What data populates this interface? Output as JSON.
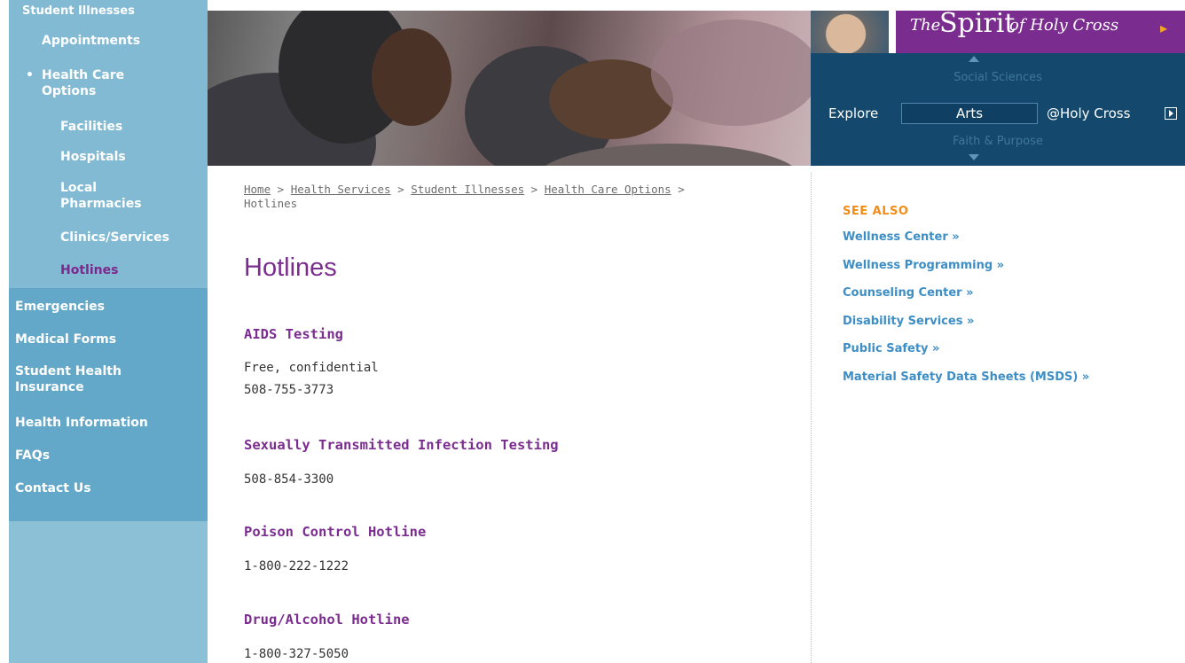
{
  "left_nav": {
    "sub_items": [
      {
        "label": "Student Illnesses"
      },
      {
        "label": "Appointments"
      },
      {
        "label": "Health Care Options",
        "bullet": "•"
      },
      {
        "label": "Facilities"
      },
      {
        "label": "Hospitals"
      },
      {
        "label": "Local Pharmacies"
      },
      {
        "label": "Clinics/Services"
      },
      {
        "label": "Hotlines"
      }
    ],
    "main_items": [
      {
        "label": "Emergencies"
      },
      {
        "label": "Medical Forms"
      },
      {
        "label": "Student Health Insurance"
      },
      {
        "label": "Health Information"
      },
      {
        "label": "FAQs"
      },
      {
        "label": "Contact Us"
      }
    ]
  },
  "header": {
    "spirit": {
      "prefix": "The",
      "big": "Spirit",
      "suffix": "of Holy Cross",
      "arrow": "▸"
    },
    "explore": {
      "label": "Explore",
      "above": "Social Sciences",
      "current": "Arts",
      "below": "Faith & Purpose",
      "suffix": "@Holy Cross"
    }
  },
  "breadcrumb": {
    "items": [
      "Home",
      "Health Services",
      "Student Illnesses",
      "Health Care Options"
    ],
    "current": "Hotlines",
    "separator": ">"
  },
  "page_title": "Hotlines",
  "hotlines": [
    {
      "name": "AIDS Testing",
      "lines": [
        "Free, confidential",
        "508-755-3773"
      ]
    },
    {
      "name": "Sexually Transmitted Infection Testing",
      "lines": [
        "508-854-3300"
      ]
    },
    {
      "name": "Poison Control Hotline",
      "lines": [
        "1-800-222-1222"
      ]
    },
    {
      "name": "Drug/Alcohol Hotline",
      "lines": [
        "1-800-327-5050"
      ]
    }
  ],
  "see_also": {
    "title": "SEE ALSO",
    "links": [
      {
        "label": "Wellness Center  »"
      },
      {
        "label": "Wellness Programming  »"
      },
      {
        "label": "Counseling Center  »"
      },
      {
        "label": "Disability Services  »"
      },
      {
        "label": "Public Safety  »"
      },
      {
        "label": "Material Safety Data Sheets (MSDS) »"
      }
    ]
  },
  "colors": {
    "purple": "#7b2d8f",
    "nav_blue": "#63a8c9",
    "link_blue": "#3d8ec4",
    "orange": "#f28c16",
    "explore_navy": "#14486c"
  }
}
